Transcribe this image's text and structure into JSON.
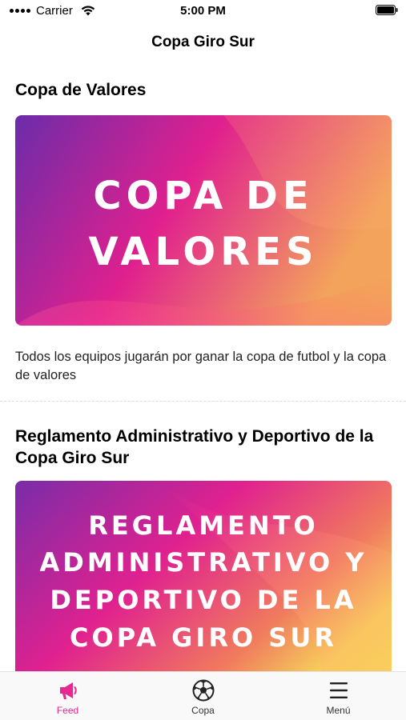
{
  "status_bar": {
    "carrier": "Carrier",
    "time": "5:00 PM"
  },
  "header": {
    "title": "Copa Giro Sur"
  },
  "feed": [
    {
      "title": "Copa de Valores",
      "image_text": [
        "COPA DE",
        "VALORES"
      ],
      "description": "Todos los equipos jugarán por ganar la copa de futbol y la copa de valores"
    },
    {
      "title": "Reglamento Administrativo y Deportivo de la Copa Giro Sur",
      "image_text": [
        "REGLAMENTO",
        "ADMINISTRATIVO Y",
        "DEPORTIVO DE LA",
        "COPA GIRO SUR"
      ]
    }
  ],
  "tabs": [
    {
      "label": "Feed",
      "icon": "megaphone-icon",
      "active": true
    },
    {
      "label": "Copa",
      "icon": "soccer-ball-icon",
      "active": false
    },
    {
      "label": "Menú",
      "icon": "menu-icon",
      "active": false
    }
  ],
  "colors": {
    "accent": "#e22a8f",
    "gradient_start": "#6a2da8",
    "gradient_mid": "#e0208f",
    "gradient_end": "#f5a85a"
  }
}
